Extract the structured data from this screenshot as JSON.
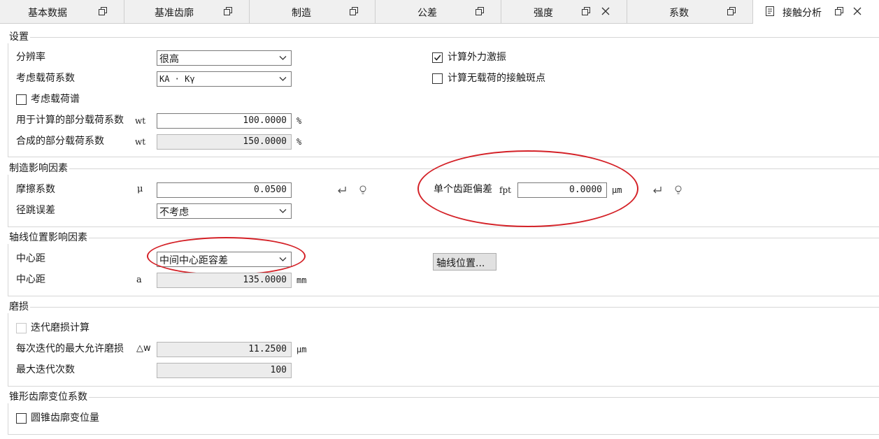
{
  "tabs": [
    {
      "label": "基本数据"
    },
    {
      "label": "基准齿廓"
    },
    {
      "label": "制造"
    },
    {
      "label": "公差"
    },
    {
      "label": "强度"
    },
    {
      "label": "系数"
    },
    {
      "label": "接触分析"
    }
  ],
  "settings": {
    "title": "设置",
    "resolution": {
      "label": "分辨率",
      "value": "很高"
    },
    "load_factor": {
      "label": "考虑载荷系数",
      "value": "KA · Kγ"
    },
    "load_spectrum": {
      "label": "考虑载荷谱",
      "checked": false
    },
    "partial_load": {
      "label": "用于计算的部分载荷系数",
      "symbol": "wt",
      "value": "100.0000",
      "unit": "%"
    },
    "resulting_load": {
      "label": "合成的部分载荷系数",
      "symbol": "wt",
      "value": "150.0000",
      "unit": "%"
    },
    "external_excitation": {
      "label": "计算外力激振",
      "checked": true
    },
    "no_load_contact": {
      "label": "计算无载荷的接触斑点",
      "checked": false
    }
  },
  "manufacturing": {
    "title": "制造影响因素",
    "friction": {
      "label": "摩擦系数",
      "symbol": "μ",
      "value": "0.0500"
    },
    "runout": {
      "label": "径跳误差",
      "value": "不考虑"
    },
    "pitch_deviation": {
      "label": "单个齿距偏差",
      "symbol": "fpt",
      "value": "0.0000",
      "unit": "μm"
    }
  },
  "axis": {
    "title": "轴线位置影响因素",
    "center_mode": {
      "label": "中心距",
      "value": "中间中心距容差"
    },
    "center_distance": {
      "label": "中心距",
      "symbol": "a",
      "value": "135.0000",
      "unit": "mm"
    },
    "axis_button": "轴线位置..."
  },
  "wear": {
    "title": "磨损",
    "iterative": {
      "label": "迭代磨损计算",
      "checked": false
    },
    "max_wear": {
      "label": "每次迭代的最大允许磨损",
      "symbol": "△w",
      "value": "11.2500",
      "unit": "μm"
    },
    "max_iter": {
      "label": "最大迭代次数",
      "value": "100"
    }
  },
  "bevel": {
    "title": "锥形齿廓变位系数",
    "conical": {
      "label": "圆锥齿廓变位量",
      "checked": false
    }
  },
  "colors": {
    "highlight": "#d42127"
  }
}
